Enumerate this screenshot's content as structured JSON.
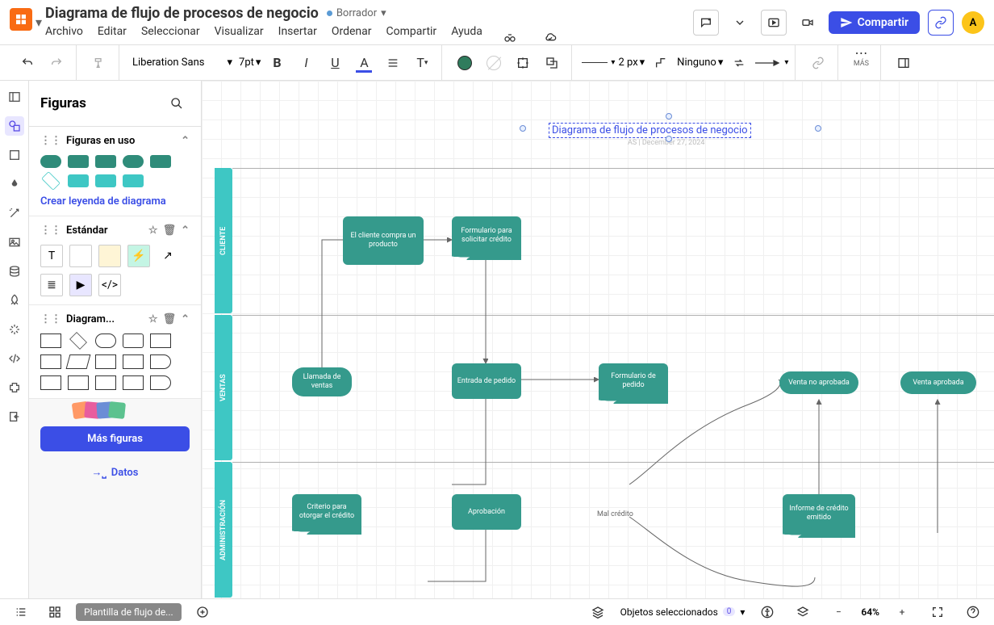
{
  "header": {
    "title": "Diagrama de flujo de procesos de negocio",
    "status": "Borrador",
    "avatar": "A",
    "menu": [
      "Archivo",
      "Editar",
      "Seleccionar",
      "Visualizar",
      "Insertar",
      "Ordenar",
      "Compartir",
      "Ayuda"
    ],
    "share_label": "Compartir"
  },
  "toolbar": {
    "font": "Liberation Sans",
    "size": "7pt",
    "stroke_width": "2 px",
    "line_end": "Ninguno",
    "more_label": "MÁS"
  },
  "shapes_panel": {
    "title": "Figuras",
    "sections": {
      "in_use": "Figuras en uso",
      "legend_link": "Crear leyenda de diagrama",
      "standard": "Estándar",
      "flowchart": "Diagram..."
    },
    "more_shapes": "Más figuras",
    "data_link": "Datos"
  },
  "canvas": {
    "title_text": "Diagrama de flujo de procesos de negocio",
    "subtitle": "AS   |   December 27, 2024",
    "lanes": {
      "cliente": "CLIENTE",
      "ventas": "VENTAS",
      "admin": "ADMINISTRACIÓN"
    },
    "nodes": {
      "n1": "El cliente compra un producto",
      "n2": "Formulario para solicitar crédito",
      "n3": "Llamada de ventas",
      "n4": "Entrada de pedido",
      "n5": "Formulario de pedido",
      "n6": "Venta no aprobada",
      "n7": "Venta aprobada",
      "n8": "Criterio para otorgar el crédito",
      "n9": "Aprobación",
      "n10": "Informe de crédito emitido",
      "bad_credit": "Mal crédito"
    }
  },
  "footer": {
    "page_tab": "Plantilla de flujo de...",
    "selected_label": "Objetos seleccionados",
    "selected_count": "0",
    "zoom": "64%"
  }
}
